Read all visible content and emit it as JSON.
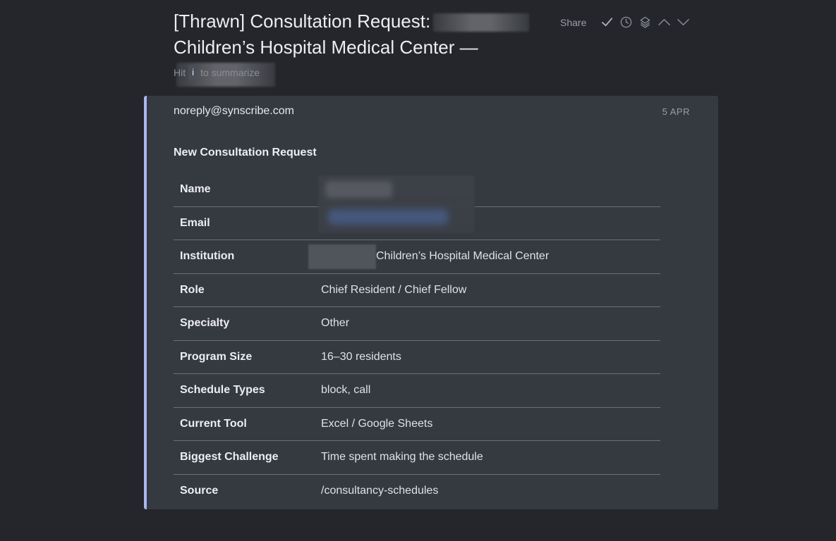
{
  "email": {
    "subject_line1": "[Thrawn] Consultation Request:",
    "subject_line2": "Children’s Hospital Medical Center —",
    "hint_prefix": "Hit",
    "hint_key": "i",
    "hint_suffix": "to summarize",
    "sender": "noreply@synscribe.com",
    "date": "5 APR",
    "body_title": "New Consultation Request"
  },
  "toolbar": {
    "share_label": "Share",
    "icons": [
      "check-icon",
      "clock-icon",
      "layers-icon",
      "chevron-up-icon",
      "chevron-down-icon"
    ]
  },
  "details": [
    {
      "label": "Name",
      "value": ""
    },
    {
      "label": "Email",
      "value": ""
    },
    {
      "label": "Institution",
      "value": "Children’s Hospital Medical Center"
    },
    {
      "label": "Role",
      "value": "Chief Resident / Chief Fellow"
    },
    {
      "label": "Specialty",
      "value": "Other"
    },
    {
      "label": "Program Size",
      "value": "16–30 residents"
    },
    {
      "label": "Schedule Types",
      "value": "block, call"
    },
    {
      "label": "Current Tool",
      "value": "Excel / Google Sheets"
    },
    {
      "label": "Biggest Challenge",
      "value": "Time spent making the schedule"
    },
    {
      "label": "Source",
      "value": "/consultancy-schedules"
    }
  ],
  "colors": {
    "background": "#24262b",
    "card": "#353940",
    "accent_border": "#a9b6f0"
  }
}
